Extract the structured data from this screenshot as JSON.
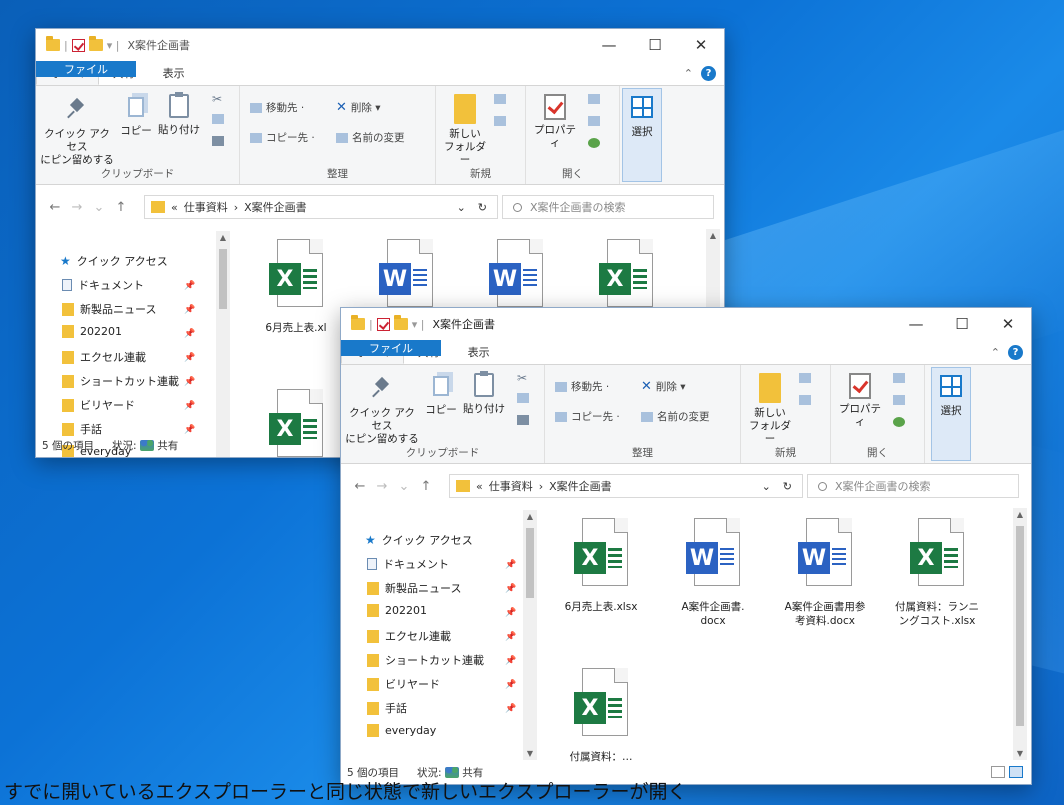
{
  "title_sep": "|",
  "title_sep2": "▾ |",
  "window_title": "X案件企画書",
  "controls": {
    "minimize": "—",
    "maximize": "☐",
    "close": "✕"
  },
  "tabs": {
    "file": "ファイル",
    "home": "ホーム",
    "share": "共有",
    "view": "表示"
  },
  "ribbon": {
    "pin": "クイック アクセス\nにピン留めする",
    "copy": "コピー",
    "paste": "貼り付け",
    "move_to": "移動先 ·",
    "delete": "削除 ▾",
    "copy_to": "コピー先 ·",
    "rename": "名前の変更",
    "new_folder": "新しい\nフォルダー",
    "properties": "プロパティ",
    "select": "選択",
    "groups": {
      "clipboard": "クリップボード",
      "organize": "整理",
      "new": "新規",
      "open": "開く"
    }
  },
  "address": {
    "prefix": "«",
    "crumb1": "仕事資料",
    "sep": "›",
    "crumb2": "X案件企画書",
    "dropdown": "⌄",
    "refresh": "↻"
  },
  "search_placeholder": "X案件企画書の検索",
  "nav": {
    "quick_access": "クイック アクセス",
    "items": [
      "ドキュメント",
      "新製品ニュース",
      "202201",
      "エクセル連載",
      "ショートカット連載",
      "ビリヤード",
      "手話",
      "everyday"
    ]
  },
  "files": [
    {
      "name": "6月売上表.xlsx",
      "type": "excel",
      "letter": "X"
    },
    {
      "name": "A案件企画書.\ndocx",
      "type": "word",
      "letter": "W"
    },
    {
      "name": "A案件企画書用参\n考資料.docx",
      "type": "word",
      "letter": "W"
    },
    {
      "name": "付属資料：ランニ\nングコスト.xlsx",
      "type": "excel",
      "letter": "X"
    },
    {
      "name": "付属資料：…",
      "type": "excel",
      "letter": "X"
    }
  ],
  "back_window": {
    "file1_label": "6月売上表.xl"
  },
  "status": {
    "count": "5 個の項目",
    "state_label": "状況:",
    "state_value": "共有"
  },
  "caption": "すでに開いているエクスプローラーと同じ状態で新しいエクスプローラーが開く",
  "colors": {
    "accent": "#1979ca",
    "excel": "#1d7a43",
    "word": "#2b62c2",
    "folder": "#f2c13b"
  }
}
